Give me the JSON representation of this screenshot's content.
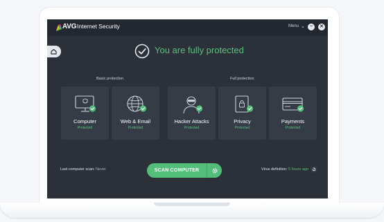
{
  "app": {
    "brand": "AVG",
    "product": "Internet Security",
    "menu_label": "Menu",
    "minimize_glyph": "−",
    "close_glyph": "✕"
  },
  "status": {
    "message": "You are fully protected"
  },
  "groups": {
    "basic_label": "Basic protection",
    "full_label": "Full protection"
  },
  "cards": [
    {
      "title": "Computer",
      "status": "Protected",
      "icon": "computer-icon"
    },
    {
      "title": "Web & Email",
      "status": "Protected",
      "icon": "globe-icon"
    },
    {
      "title": "Hacker Attacks",
      "status": "Protected",
      "icon": "hacker-icon"
    },
    {
      "title": "Privacy",
      "status": "Protected",
      "icon": "lock-icon"
    },
    {
      "title": "Payments",
      "status": "Protected",
      "icon": "credit-card-icon"
    }
  ],
  "footer": {
    "last_scan_label": "Last computer scan:",
    "last_scan_value": "Never",
    "scan_button_label": "SCAN COMPUTER",
    "virus_def_label": "Virus definition:",
    "virus_def_value": "5 hours ago"
  },
  "colors": {
    "accent_green": "#53bd7a",
    "screen_bg": "#2b3039",
    "card_bg": "#363c46",
    "titlebar_bg": "#232830"
  }
}
